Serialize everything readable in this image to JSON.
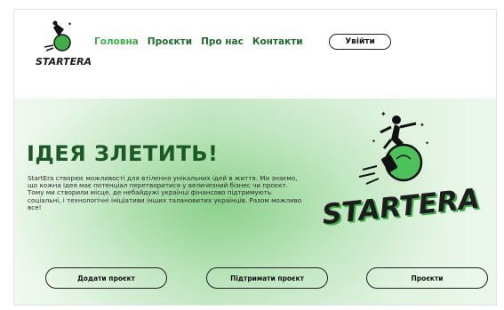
{
  "brand": {
    "name": "STARTERA"
  },
  "nav": {
    "items": [
      {
        "label": "Головна",
        "active": true
      },
      {
        "label": "Проєкти",
        "active": false
      },
      {
        "label": "Про нас",
        "active": false
      },
      {
        "label": "Контакти",
        "active": false
      }
    ]
  },
  "header": {
    "login_label": "Увійти"
  },
  "hero": {
    "title": "ІДЕЯ ЗЛЕТИТЬ!",
    "description": "StartEra створює можливості для втілення унікальних ідей в життя. Ми знаємо, що кожна ідея має потенціал перетворитися у величезний бізнес чи проєкт. Тому ми створили місце, де небайдужі українці фінансово підтримують соціальні, і технологічні ініціативи інших талановитих українців. Разом можливо все!"
  },
  "actions": {
    "add_project": "Додати проєкт",
    "support_project": "Підтримати проєкт",
    "projects": "Проєкти"
  },
  "colors": {
    "accent": "#3fae49",
    "nav_green": "#1d6b2a",
    "title_green": "#1c5a25"
  },
  "icons": [
    "rocket-man-logo-icon",
    "lightbulb-icon",
    "star-icon"
  ]
}
